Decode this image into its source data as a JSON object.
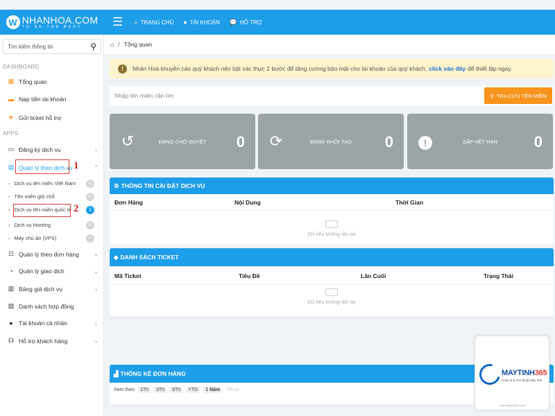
{
  "logo": {
    "mark": "W",
    "name": "NHANHOA.COM",
    "tagline": "TO BE THE BEST"
  },
  "nav": {
    "menu_icon": "hamburger-icon",
    "links": [
      {
        "label": "TRANG CHỦ",
        "icon": "home-icon"
      },
      {
        "label": "TÀI KHOẢN",
        "icon": "user-icon"
      },
      {
        "label": "HỖ TRỢ",
        "icon": "chat-icon"
      }
    ]
  },
  "sidebar": {
    "search_placeholder": "Tìm kiếm thông tin",
    "dashboard_label": "DASHBOARD",
    "apps_label": "APPS",
    "dashboard_items": [
      {
        "label": "Tổng quan",
        "icon": "grid-icon"
      },
      {
        "label": "Nạp tiền tài khoản",
        "icon": "wallet-icon"
      },
      {
        "label": "Gửi ticket hỗ trợ",
        "icon": "send-icon"
      }
    ],
    "app_items": [
      {
        "label": "Đăng ký dịch vụ",
        "icon": "keyboard-icon"
      },
      {
        "label": "Quản lý theo dịch vụ",
        "icon": "server-icon"
      }
    ],
    "sub_items": [
      {
        "label": "Dịch vụ tên miền Việt Nam",
        "count": "0"
      },
      {
        "label": "Tên miền giữ chỗ",
        "count": "0"
      },
      {
        "label": "Dịch vụ tên miền quốc tế",
        "count": "1"
      },
      {
        "label": "Dịch vụ Hosting",
        "count": "0"
      },
      {
        "label": "Máy chủ ảo (VPS)",
        "count": "0"
      }
    ],
    "more_items": [
      {
        "label": "Quản lý theo đơn hàng",
        "icon": "list-icon"
      },
      {
        "label": "Quản lý giao dịch",
        "icon": "pie-chart-icon"
      },
      {
        "label": "Bảng giá dịch vụ",
        "icon": "clipboard-icon"
      },
      {
        "label": "Danh sách hợp đồng",
        "icon": "document-icon"
      },
      {
        "label": "Tài khoản cá nhân",
        "icon": "user-icon"
      },
      {
        "label": "Hỗ trợ khách hàng",
        "icon": "headset-icon"
      }
    ],
    "annotations": [
      "1",
      "2"
    ]
  },
  "breadcrumb": {
    "current": "Tổng quan"
  },
  "alert": {
    "text_before": "Nhân Hoà khuyến cáo quý khách nên bật xác thực 2 bước để tăng cường bảo mật cho tài khoản của quý khách,",
    "link": "click vào đây",
    "text_after": "để thiết lập ngay."
  },
  "domain_search": {
    "placeholder": "Nhập tên miền cần tìm",
    "button": "TRA CỨU TÊN MIỀN"
  },
  "stats": [
    {
      "label": "ĐANG CHỜ DUYỆT",
      "value": "0",
      "icon": "history-icon"
    },
    {
      "label": "ĐANG KHỞI TẠO",
      "value": "0",
      "icon": "refresh-icon"
    },
    {
      "label": "SẮP HẾT HẠN",
      "value": "0",
      "icon": "warning-icon"
    }
  ],
  "services_panel": {
    "title": "THÔNG TIN CÀI ĐẶT DỊCH VỤ",
    "columns": [
      "Đơn Hàng",
      "Nội Dung",
      "Thời Gian"
    ],
    "empty": "Dữ liệu không tồn tại"
  },
  "ticket_panel": {
    "title": "DANH SÁCH TICKET",
    "columns": [
      "Mã Ticket",
      "Tiêu Đề",
      "Lần Cuối",
      "Trạng Thái"
    ],
    "empty": "Dữ liệu không tồn tại"
  },
  "orders_panel": {
    "title": "THỐNG KÊ ĐƠN HÀNG",
    "filter_label": "Xem theo",
    "options": [
      "1Th",
      "3Th",
      "6Th",
      "YTD",
      "1 Năm",
      "Tất cả"
    ],
    "selected": "1 Năm"
  },
  "watermark": {
    "name_a": "MAYTINH",
    "name_b": "365",
    "tagline": "Chia sẻ & Thủ thuật Máy tính",
    "footer": "www.maytinh365.com.vn"
  },
  "colors": {
    "primary": "#1e9de8",
    "orange": "#f7941d",
    "stat_bg": "#9aa3a5",
    "alert_bg": "#fdf3cc"
  }
}
